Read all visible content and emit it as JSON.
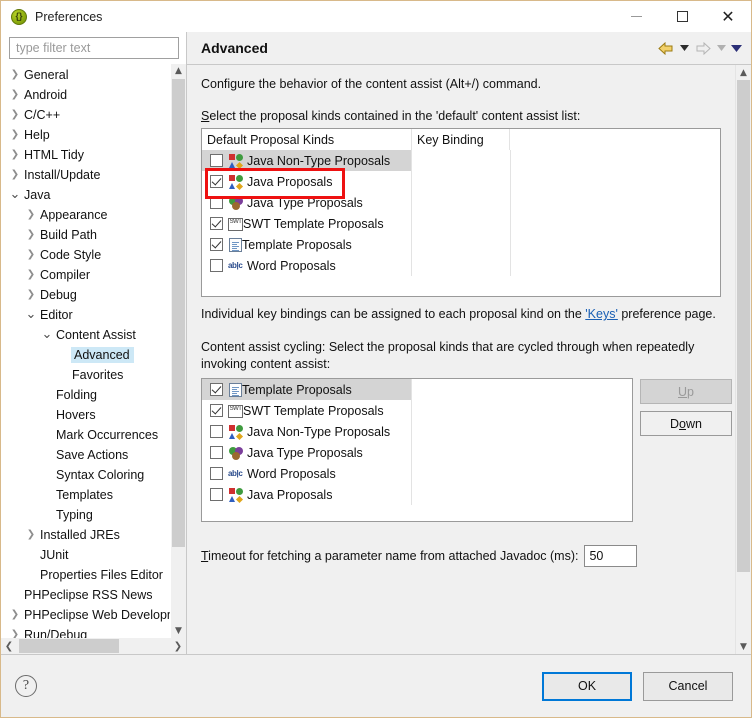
{
  "window": {
    "title": "Preferences",
    "icon": "java-braces-icon",
    "minimize_label": "Minimize",
    "maximize_label": "Maximize",
    "close_label": "Close"
  },
  "sidebar": {
    "filter": {
      "value": "",
      "placeholder": "type filter text"
    },
    "items": [
      {
        "label": "General",
        "indent": 0,
        "twisty": "collapsed",
        "selected": false
      },
      {
        "label": "Android",
        "indent": 0,
        "twisty": "collapsed",
        "selected": false
      },
      {
        "label": "C/C++",
        "indent": 0,
        "twisty": "collapsed",
        "selected": false
      },
      {
        "label": "Help",
        "indent": 0,
        "twisty": "collapsed",
        "selected": false
      },
      {
        "label": "HTML Tidy",
        "indent": 0,
        "twisty": "collapsed",
        "selected": false
      },
      {
        "label": "Install/Update",
        "indent": 0,
        "twisty": "collapsed",
        "selected": false
      },
      {
        "label": "Java",
        "indent": 0,
        "twisty": "expanded",
        "selected": false
      },
      {
        "label": "Appearance",
        "indent": 1,
        "twisty": "collapsed",
        "selected": false
      },
      {
        "label": "Build Path",
        "indent": 1,
        "twisty": "collapsed",
        "selected": false
      },
      {
        "label": "Code Style",
        "indent": 1,
        "twisty": "collapsed",
        "selected": false
      },
      {
        "label": "Compiler",
        "indent": 1,
        "twisty": "collapsed",
        "selected": false
      },
      {
        "label": "Debug",
        "indent": 1,
        "twisty": "collapsed",
        "selected": false
      },
      {
        "label": "Editor",
        "indent": 1,
        "twisty": "expanded",
        "selected": false
      },
      {
        "label": "Content Assist",
        "indent": 2,
        "twisty": "expanded",
        "selected": false
      },
      {
        "label": "Advanced",
        "indent": 3,
        "twisty": "none",
        "selected": true
      },
      {
        "label": "Favorites",
        "indent": 3,
        "twisty": "none",
        "selected": false
      },
      {
        "label": "Folding",
        "indent": 2,
        "twisty": "none",
        "selected": false
      },
      {
        "label": "Hovers",
        "indent": 2,
        "twisty": "none",
        "selected": false
      },
      {
        "label": "Mark Occurrences",
        "indent": 2,
        "twisty": "none",
        "selected": false
      },
      {
        "label": "Save Actions",
        "indent": 2,
        "twisty": "none",
        "selected": false
      },
      {
        "label": "Syntax Coloring",
        "indent": 2,
        "twisty": "none",
        "selected": false
      },
      {
        "label": "Templates",
        "indent": 2,
        "twisty": "none",
        "selected": false
      },
      {
        "label": "Typing",
        "indent": 2,
        "twisty": "none",
        "selected": false
      },
      {
        "label": "Installed JREs",
        "indent": 1,
        "twisty": "collapsed",
        "selected": false
      },
      {
        "label": "JUnit",
        "indent": 1,
        "twisty": "none",
        "selected": false
      },
      {
        "label": "Properties Files Editor",
        "indent": 1,
        "twisty": "none",
        "selected": false
      },
      {
        "label": "PHPeclipse RSS News",
        "indent": 0,
        "twisty": "none",
        "selected": false
      },
      {
        "label": "PHPeclipse Web Development",
        "indent": 0,
        "twisty": "collapsed",
        "selected": false
      },
      {
        "label": "Run/Debug",
        "indent": 0,
        "twisty": "collapsed",
        "selected": false
      }
    ]
  },
  "page": {
    "title": "Advanced",
    "nav": {
      "back_icon": "back-arrow-icon",
      "back_menu_icon": "chevron-down-icon",
      "forward_icon": "forward-arrow-icon",
      "forward_menu_icon": "chevron-down-icon",
      "menu_icon": "chevron-down-icon"
    },
    "description": "Configure the behavior of the content assist (Alt+/) command.",
    "default_kinds_label": "Select the proposal kinds contained in the 'default' content assist list:",
    "default_table": {
      "columns": [
        "Default Proposal Kinds",
        "Key Binding",
        ""
      ],
      "rows": [
        {
          "label": "Java Non-Type Proposals",
          "checked": false,
          "icon": "java-nontype-icon",
          "highlighted": true
        },
        {
          "label": "Java Proposals",
          "checked": true,
          "icon": "java-proposals-icon",
          "highlighted": false
        },
        {
          "label": "Java Type Proposals",
          "checked": false,
          "icon": "java-type-icon",
          "highlighted": false
        },
        {
          "label": "SWT Template Proposals",
          "checked": true,
          "icon": "swt-template-icon",
          "highlighted": false
        },
        {
          "label": "Template Proposals",
          "checked": true,
          "icon": "template-icon",
          "highlighted": false
        },
        {
          "label": "Word Proposals",
          "checked": false,
          "icon": "word-proposals-icon",
          "highlighted": false
        }
      ]
    },
    "annotation": {
      "color": "#ee1111",
      "target": "Java Proposals"
    },
    "keybinding_note_prefix": "Individual key bindings can be assigned to each proposal kind on the ",
    "keybinding_link": "'Keys'",
    "keybinding_note_suffix": " preference page.",
    "cycling_label": "Content assist cycling: Select the proposal kinds that are cycled through when repeatedly invoking content assist:",
    "cycling_table": {
      "rows": [
        {
          "label": "Template Proposals",
          "checked": true,
          "icon": "template-icon",
          "highlighted": true
        },
        {
          "label": "SWT Template Proposals",
          "checked": true,
          "icon": "swt-template-icon",
          "highlighted": false
        },
        {
          "label": "Java Non-Type Proposals",
          "checked": false,
          "icon": "java-nontype-icon",
          "highlighted": false
        },
        {
          "label": "Java Type Proposals",
          "checked": false,
          "icon": "java-type-icon",
          "highlighted": false
        },
        {
          "label": "Word Proposals",
          "checked": false,
          "icon": "word-proposals-icon",
          "highlighted": false
        },
        {
          "label": "Java Proposals",
          "checked": false,
          "icon": "java-proposals-icon",
          "highlighted": false
        }
      ]
    },
    "up_button": {
      "label": "Up",
      "enabled": false
    },
    "down_button": {
      "label": "Down",
      "enabled": true
    },
    "timeout_label": "Timeout for fetching a parameter name from attached Javadoc (ms):",
    "timeout_value": "50"
  },
  "footer": {
    "help_icon": "help-question-icon",
    "ok_label": "OK",
    "cancel_label": "Cancel"
  }
}
